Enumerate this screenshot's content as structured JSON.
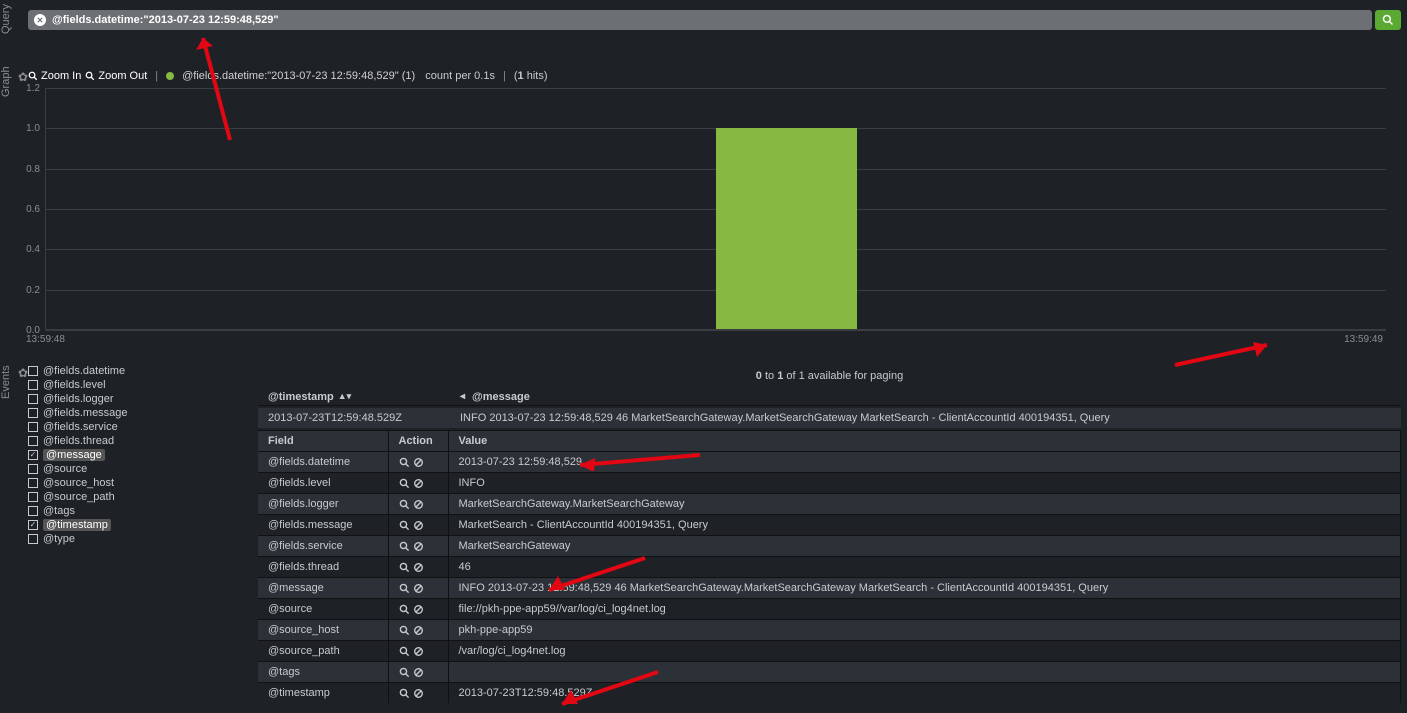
{
  "sidebar_labels": {
    "query": "Query",
    "graph": "Graph",
    "events": "Events"
  },
  "query": {
    "text": "@fields.datetime:\"2013-07-23 12:59:48,529\""
  },
  "graph": {
    "zoom_in": "Zoom In",
    "zoom_out": "Zoom Out",
    "legend": "@fields.datetime:\"2013-07-23 12:59:48,529\" (1)",
    "count_label": "count per 0.1s",
    "hits_pre": "(",
    "hits_n": "1",
    "hits_post": " hits)"
  },
  "chart_data": {
    "type": "bar",
    "x": [
      "13:59:48",
      "13:59:49"
    ],
    "categories": [
      "13:59:48.0",
      "13:59:48.1",
      "13:59:48.2",
      "13:59:48.3",
      "13:59:48.4",
      "13:59:48.5",
      "13:59:48.6",
      "13:59:48.7",
      "13:59:48.8",
      "13:59:48.9"
    ],
    "values": [
      0,
      0,
      0,
      0,
      0,
      1,
      0,
      0,
      0,
      0
    ],
    "ylim": [
      0,
      1.2
    ],
    "yticks": [
      0.0,
      0.2,
      0.4,
      0.6,
      0.8,
      1.0,
      1.2
    ],
    "title": "",
    "xlabel": "",
    "ylabel": ""
  },
  "paging": {
    "from": "0",
    "to": "1",
    "of": "1",
    "text": " of ",
    "suffix": " available for paging"
  },
  "fields": [
    {
      "name": "@fields.datetime",
      "checked": false,
      "badge": false
    },
    {
      "name": "@fields.level",
      "checked": false,
      "badge": false
    },
    {
      "name": "@fields.logger",
      "checked": false,
      "badge": false
    },
    {
      "name": "@fields.message",
      "checked": false,
      "badge": false
    },
    {
      "name": "@fields.service",
      "checked": false,
      "badge": false
    },
    {
      "name": "@fields.thread",
      "checked": false,
      "badge": false
    },
    {
      "name": "@message",
      "checked": true,
      "badge": true
    },
    {
      "name": "@source",
      "checked": false,
      "badge": false
    },
    {
      "name": "@source_host",
      "checked": false,
      "badge": false
    },
    {
      "name": "@source_path",
      "checked": false,
      "badge": false
    },
    {
      "name": "@tags",
      "checked": false,
      "badge": false
    },
    {
      "name": "@timestamp",
      "checked": true,
      "badge": true
    },
    {
      "name": "@type",
      "checked": false,
      "badge": false
    }
  ],
  "event_columns": {
    "timestamp": "@timestamp",
    "message": "@message"
  },
  "event_row": {
    "timestamp": "2013-07-23T12:59:48.529Z",
    "message": "INFO 2013-07-23 12:59:48,529 46 MarketSearchGateway.MarketSearchGateway MarketSearch - ClientAccountId 400194351, Query"
  },
  "detail_headers": {
    "field": "Field",
    "action": "Action",
    "value": "Value"
  },
  "details": [
    {
      "field": "@fields.datetime",
      "value": "2013-07-23 12:59:48,529"
    },
    {
      "field": "@fields.level",
      "value": "INFO"
    },
    {
      "field": "@fields.logger",
      "value": "MarketSearchGateway.MarketSearchGateway"
    },
    {
      "field": "@fields.message",
      "value": "MarketSearch - ClientAccountId 400194351, Query"
    },
    {
      "field": "@fields.service",
      "value": "MarketSearchGateway"
    },
    {
      "field": "@fields.thread",
      "value": "46"
    },
    {
      "field": "@message",
      "value": "INFO 2013-07-23 12:59:48,529 46 MarketSearchGateway.MarketSearchGateway MarketSearch - ClientAccountId 400194351, Query"
    },
    {
      "field": "@source",
      "value": "file://pkh-ppe-app59//var/log/ci_log4net.log"
    },
    {
      "field": "@source_host",
      "value": "pkh-ppe-app59"
    },
    {
      "field": "@source_path",
      "value": "/var/log/ci_log4net.log"
    },
    {
      "field": "@tags",
      "value": ""
    },
    {
      "field": "@timestamp",
      "value": "2013-07-23T12:59:48.529Z"
    }
  ]
}
